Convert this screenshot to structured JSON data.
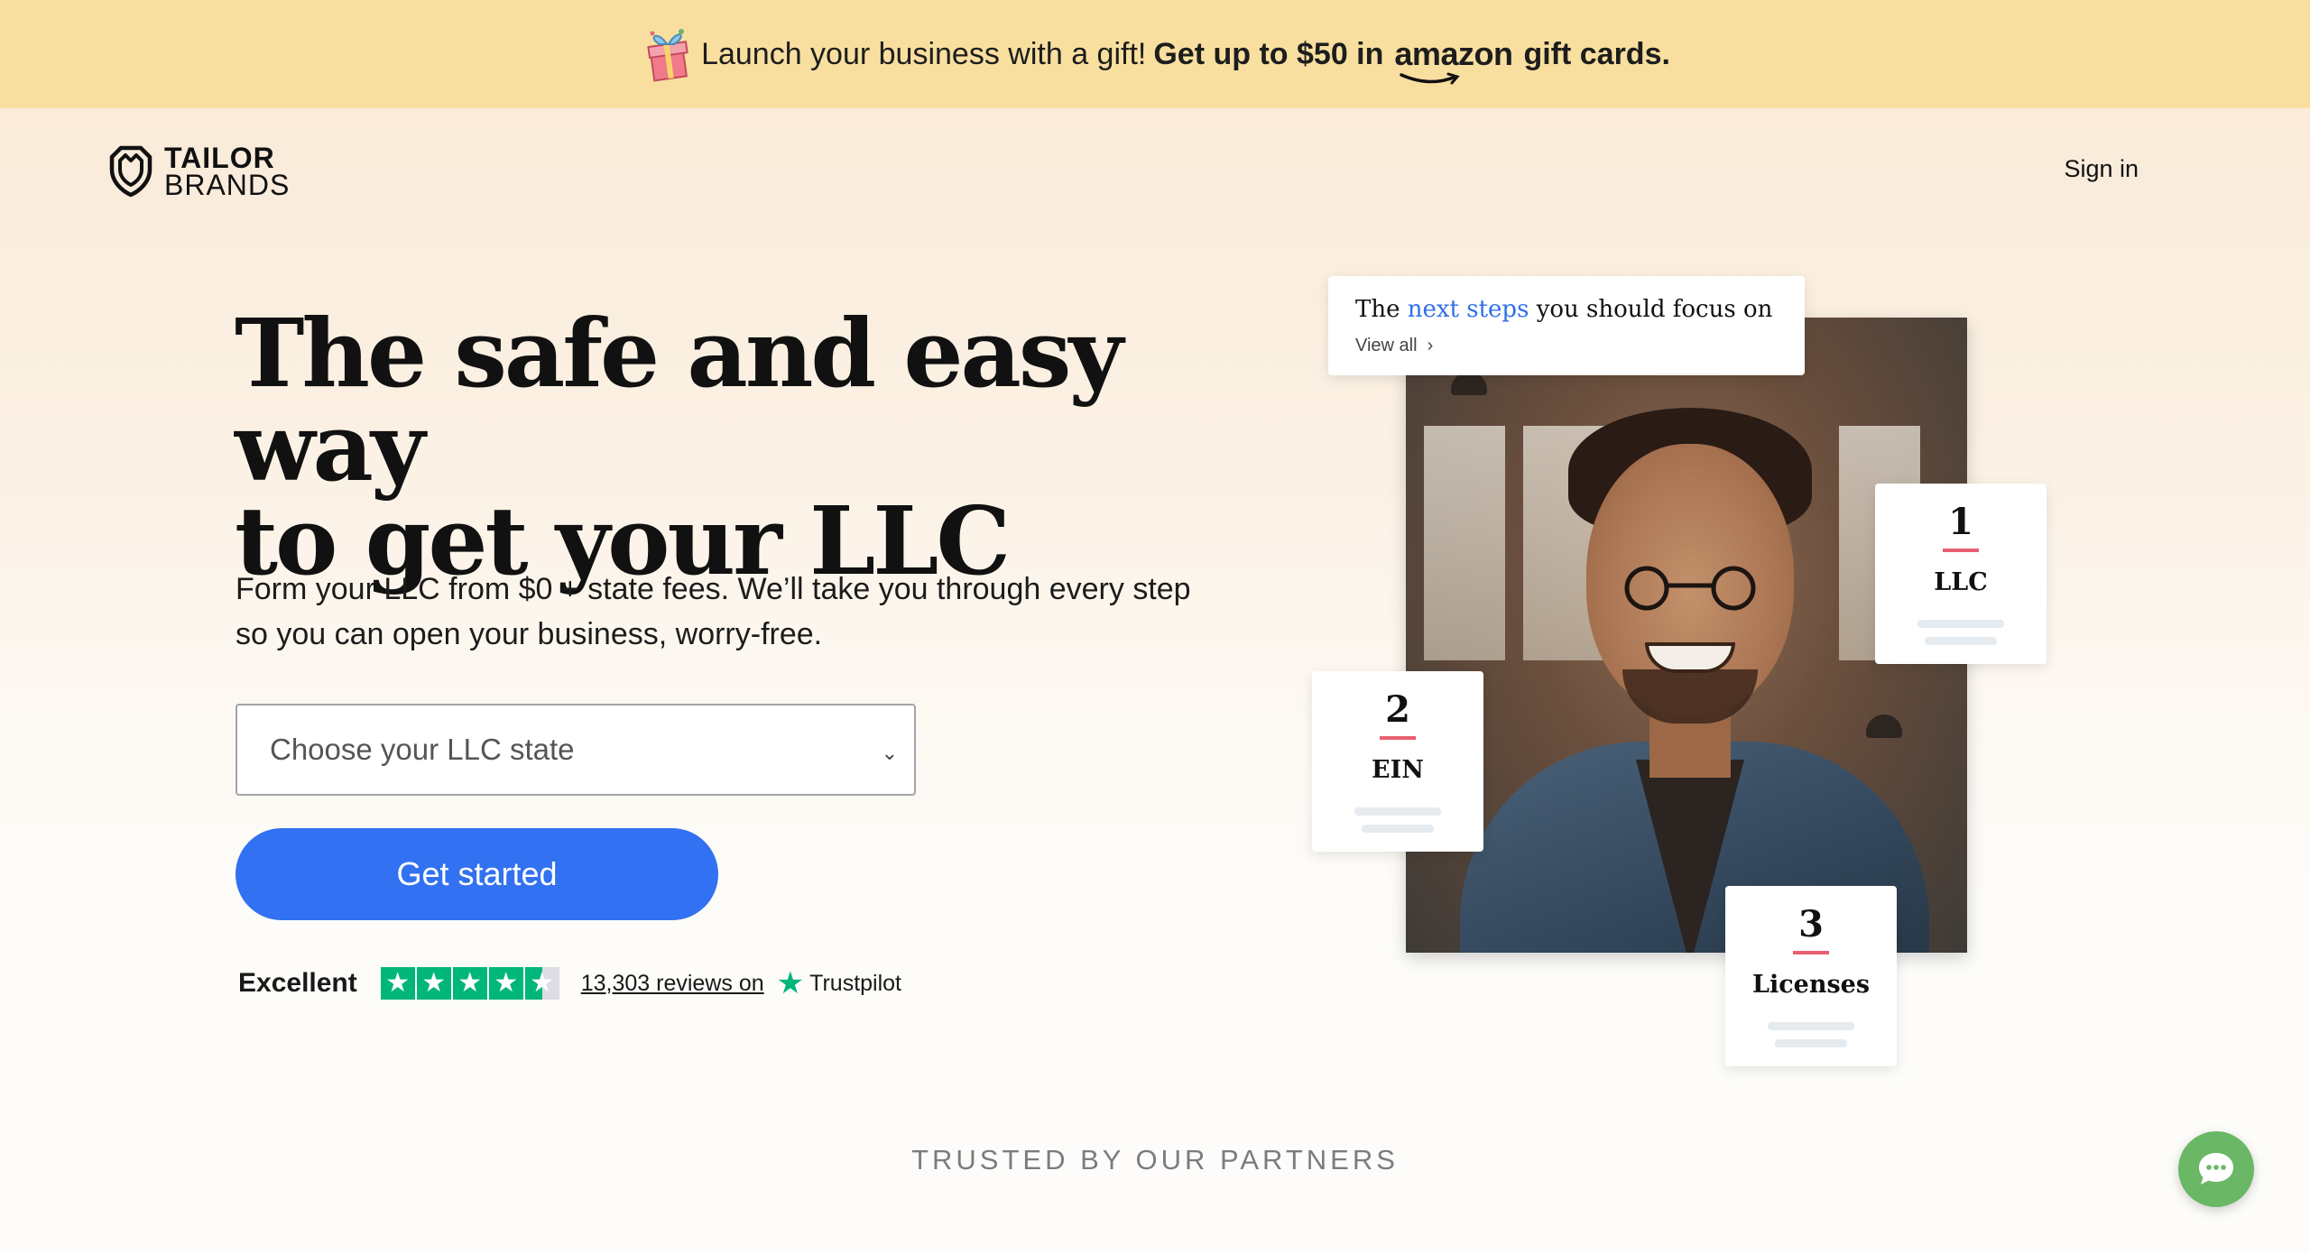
{
  "promo": {
    "lead": "Launch your business with a gift!",
    "offer": "Get up to $50 in",
    "brand": "amazon",
    "suffix": "gift cards."
  },
  "header": {
    "logo_line1": "TAILOR",
    "logo_line2": "BRANDS",
    "signin_label": "Sign in"
  },
  "hero": {
    "title_line1": "The safe and easy way",
    "title_line2": "to get your LLC",
    "subtitle_line1": "Form your LLC from $0 + state fees. We’ll take you through every step",
    "subtitle_line2": "so you can open your business, worry-free.",
    "state_select_placeholder": "Choose your LLC state",
    "cta_label": "Get started"
  },
  "rating": {
    "label": "Excellent",
    "stars": 4.5,
    "reviews_link": "13,303 reviews on",
    "provider": "Trustpilot"
  },
  "visual": {
    "focus_card": {
      "text_before": "The",
      "text_highlight": "next steps",
      "text_after": "you should focus on",
      "view_all": "View all"
    },
    "steps": [
      {
        "number": "1",
        "label": "LLC"
      },
      {
        "number": "2",
        "label": "EIN"
      },
      {
        "number": "3",
        "label": "Licenses"
      }
    ]
  },
  "partners": {
    "heading": "TRUSTED BY OUR PARTNERS"
  },
  "colors": {
    "promo_bg": "#f8df9f",
    "cta_bg": "#3271f1",
    "highlight_blue": "#2f6fe8",
    "step_accent": "#e8606f",
    "trustpilot_green": "#00b67a",
    "chat_green": "#6ab766"
  },
  "icons": {
    "promo": "gift-icon",
    "logo": "tailor-brands-logo-icon",
    "select": "chevron-down-icon",
    "view_all": "chevron-right-icon",
    "trustpilot": "star-icon",
    "chat": "chat-bubble-icon"
  }
}
